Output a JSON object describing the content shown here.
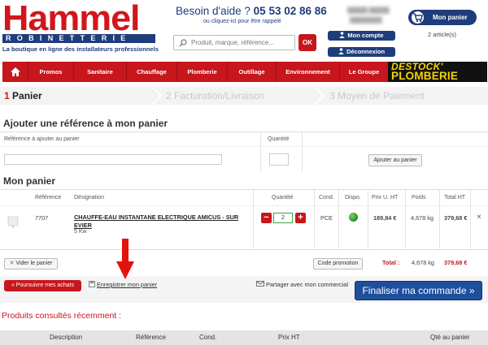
{
  "header": {
    "logo_word": "Hammel",
    "logo_sub": "ROBINETTERIE",
    "tagline": "La boutique en ligne des installateurs professionnels",
    "help_title": "Besoin d'aide ?",
    "help_phone": "05 53 02 86 86",
    "help_sub": "ou cliquez-ici pour être rappelé",
    "search_placeholder": "Produit, marque, référence...",
    "search_button": "OK",
    "account_button": "Mon compte",
    "logout_button": "Déconnexion",
    "cart_button": "Mon panier",
    "cart_count": "2 article(s)"
  },
  "nav": {
    "items": [
      "Promos",
      "Sanitaire",
      "Chauffage",
      "Plomberie",
      "Outillage",
      "Environnement",
      "Le Groupe"
    ],
    "promo_banner_line1": "DESTOCK'",
    "promo_banner_line2": "PLOMBERIE"
  },
  "steps": [
    {
      "num": "1",
      "label": "Panier"
    },
    {
      "num": "2",
      "label": "Facturation/Livraison"
    },
    {
      "num": "3",
      "label": "Moyen de Paiement"
    }
  ],
  "add_ref": {
    "title": "Ajouter une référence à mon panier",
    "ref_label": "Référence à ajouter au panier",
    "qty_label": "Quantité",
    "button": "Ajouter au panier"
  },
  "cart": {
    "title": "Mon panier",
    "columns": [
      "Référence",
      "Désignation",
      "Quantité",
      "Cond.",
      "Dispo.",
      "Prix U. HT",
      "Poids",
      "Total HT"
    ],
    "items": [
      {
        "reference": "7707",
        "designation": "CHAUFFE-EAU INSTANTANE ELECTRIQUE AMICUS - SUR EVIER",
        "sub": "5 Kw",
        "quantity": "2",
        "cond": "PCE",
        "unit_price": "189,84 €",
        "weight": "4,678 kg",
        "total": "379,68 €"
      }
    ],
    "remove_icon": "×",
    "minus": "−",
    "plus": "+",
    "empty_button": "Vider le panier",
    "promo_code_button": "Code promotion",
    "total_label": "Total :",
    "total_weight": "4,678 kg",
    "total_price": "379,68 €"
  },
  "actions": {
    "continue": "« Poursuivre mes achats",
    "save": "Enregistrer mon panier",
    "share": "Partager avec mon commercial",
    "finalize": "Finaliser ma commande »"
  },
  "recent": {
    "title": "Produits consultés récemment :",
    "columns": [
      "Description",
      "Référence",
      "Cond.",
      "Prix HT",
      "Qté au panier"
    ]
  },
  "colors": {
    "brand_red": "#c8161d",
    "brand_blue": "#1e3d7b",
    "finalize_blue": "#1e4f9c",
    "available_green": "#2a9b2a"
  }
}
